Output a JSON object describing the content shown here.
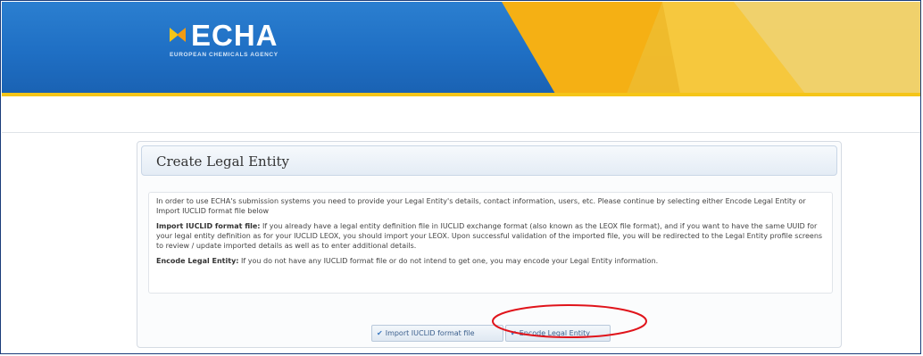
{
  "header": {
    "logo_text": "ECHA",
    "logo_subtitle": "EUROPEAN CHEMICALS AGENCY",
    "colors": {
      "blue": "#1f6fc4",
      "yellow": "#f5c518",
      "orange": "#f29b13"
    },
    "logo_icon": "echa-logo-mark-icon"
  },
  "panel": {
    "title": "Create Legal Entity",
    "intro": "In order to use ECHA's submission systems you need to provide your Legal Entity's details, contact information, users, etc. Please continue by selecting either Encode Legal Entity or Import IUCLID format file below",
    "import_heading": "Import IUCLID format file:",
    "import_text": " If you already have a legal entity definition file in IUCLID exchange format (also known as the LEOX file format), and if you want to have the same UUID for your legal entity definition as for your IUCLID LEOX, you should import your LEOX. Upon successful validation of the imported file, you will be redirected to the Legal Entity profile screens to review / update imported details as well as to enter additional details.",
    "encode_heading": "Encode Legal Entity:",
    "encode_text": " If you do not have any IUCLID format file or do not intend to get one, you may encode your Legal Entity information."
  },
  "buttons": {
    "import_label": "Import IUCLID format file",
    "encode_label": "Encode Legal Entity",
    "check_icon": "check-icon"
  },
  "annotation": {
    "highlight_color": "#e0141b"
  }
}
